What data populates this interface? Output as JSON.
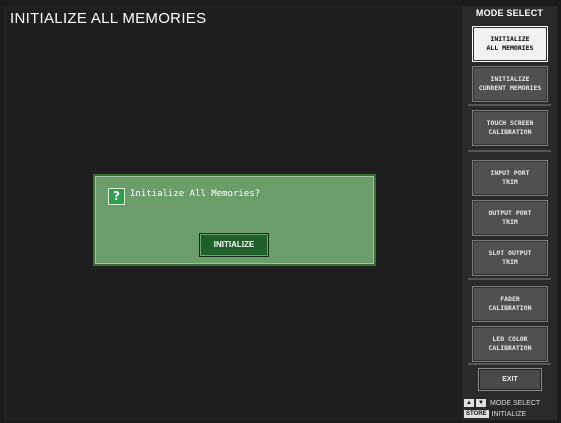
{
  "main": {
    "title": "INITIALIZE ALL MEMORIES"
  },
  "dialog": {
    "icon": "question-icon",
    "icon_glyph": "?",
    "message": "Initialize All Memories?",
    "button_label": "INITIALIZE"
  },
  "sidebar": {
    "title": "MODE SELECT",
    "buttons": [
      {
        "label_line1": "INITIALIZE",
        "label_line2": "ALL MEMORIES",
        "active": true
      },
      {
        "label_line1": "INITIALIZE",
        "label_line2": "CURRENT MEMORIES",
        "active": false
      },
      {
        "label_line1": "TOUCH SCREEN",
        "label_line2": "CALIBRATION",
        "active": false
      },
      {
        "label_line1": "INPUT PORT",
        "label_line2": "TRIM",
        "active": false
      },
      {
        "label_line1": "OUTPUT PORT",
        "label_line2": "TRIM",
        "active": false
      },
      {
        "label_line1": "SLOT OUTPUT",
        "label_line2": "TRIM",
        "active": false
      },
      {
        "label_line1": "FADER",
        "label_line2": "CALIBRATION",
        "active": false
      },
      {
        "label_line1": "LED COLOR",
        "label_line2": "CALIBRATION",
        "active": false
      }
    ],
    "exit_label": "EXIT",
    "legend": {
      "up_glyph": "▲",
      "down_glyph": "▼",
      "mode_select_text": "MODE SELECT",
      "store_key": "STORE",
      "initialize_text": "INITIALIZE"
    }
  },
  "colors": {
    "background": "#222222",
    "dialog_bg": "#6c9e6c",
    "dialog_border": "#3c6e3c",
    "button_green": "#1f5f2a",
    "active_button": "#f2f2f2"
  }
}
